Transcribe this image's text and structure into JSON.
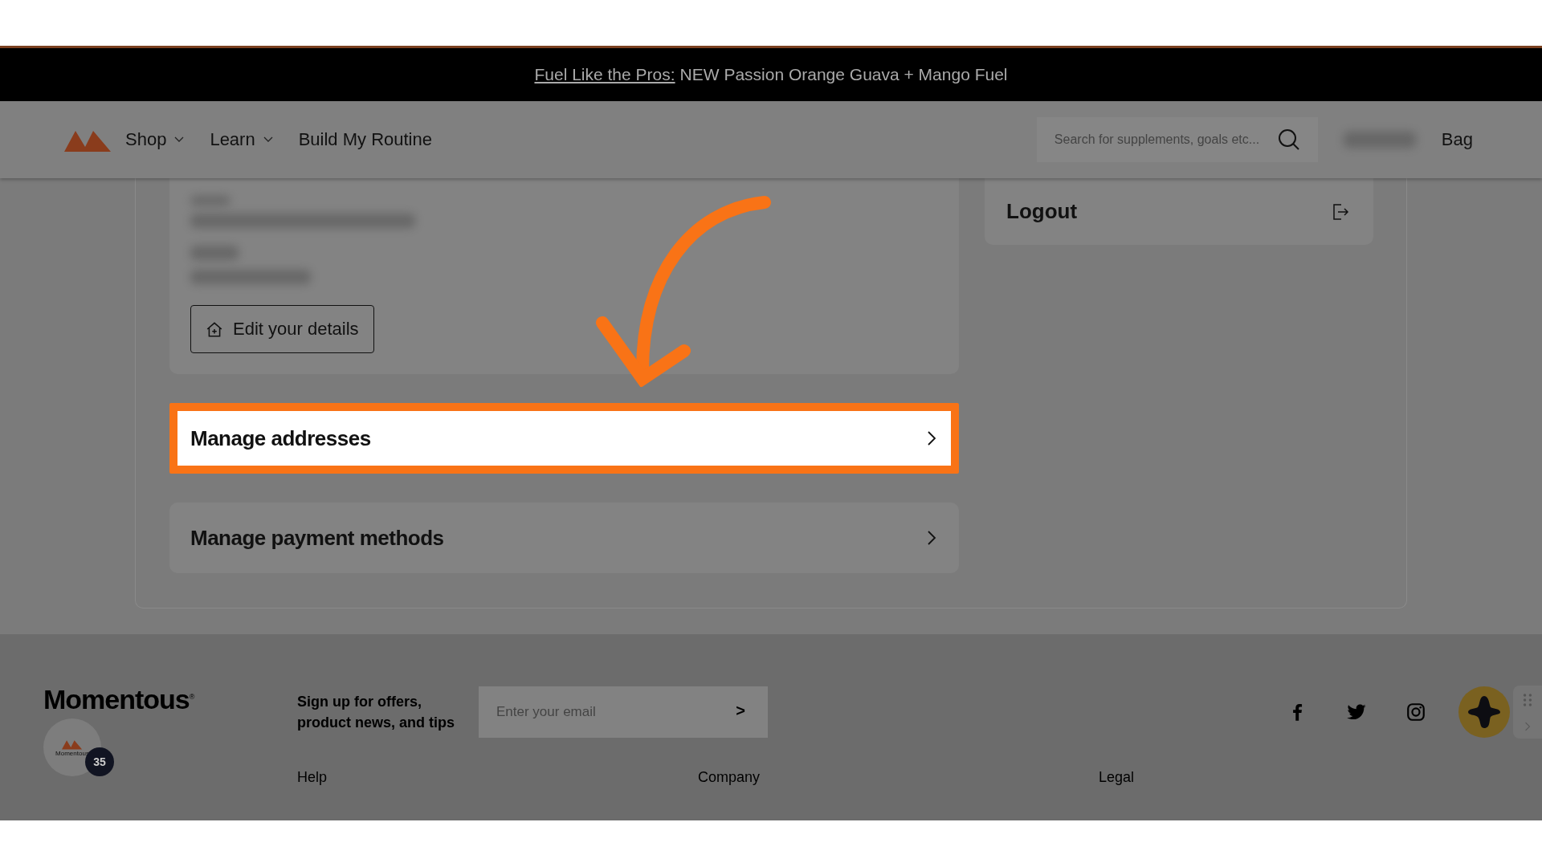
{
  "announcement": {
    "link": "Fuel Like the Pros:",
    "text": "NEW Passion Orange Guava + Mango Fuel"
  },
  "nav": {
    "items": [
      {
        "label": "Shop",
        "dropdown": true
      },
      {
        "label": "Learn",
        "dropdown": true
      },
      {
        "label": "Build My Routine",
        "dropdown": false
      }
    ],
    "search": {
      "placeholder": "Search for supplements, goals etc..."
    },
    "bag": "Bag"
  },
  "account": {
    "edit_button": "Edit your details",
    "links": [
      {
        "label": "Manage addresses",
        "highlighted": true
      },
      {
        "label": "Manage payment methods",
        "highlighted": false
      }
    ],
    "logout": "Logout"
  },
  "footer": {
    "brand": "Momentous",
    "brand_mark": "®",
    "badge_label": "Momentous",
    "badge_count": "35",
    "signup_text": "Sign up for offers, product news, and tips",
    "email": {
      "placeholder": "Enter your email",
      "submit": ">"
    },
    "columns": [
      "Help",
      "Company",
      "Legal"
    ]
  }
}
